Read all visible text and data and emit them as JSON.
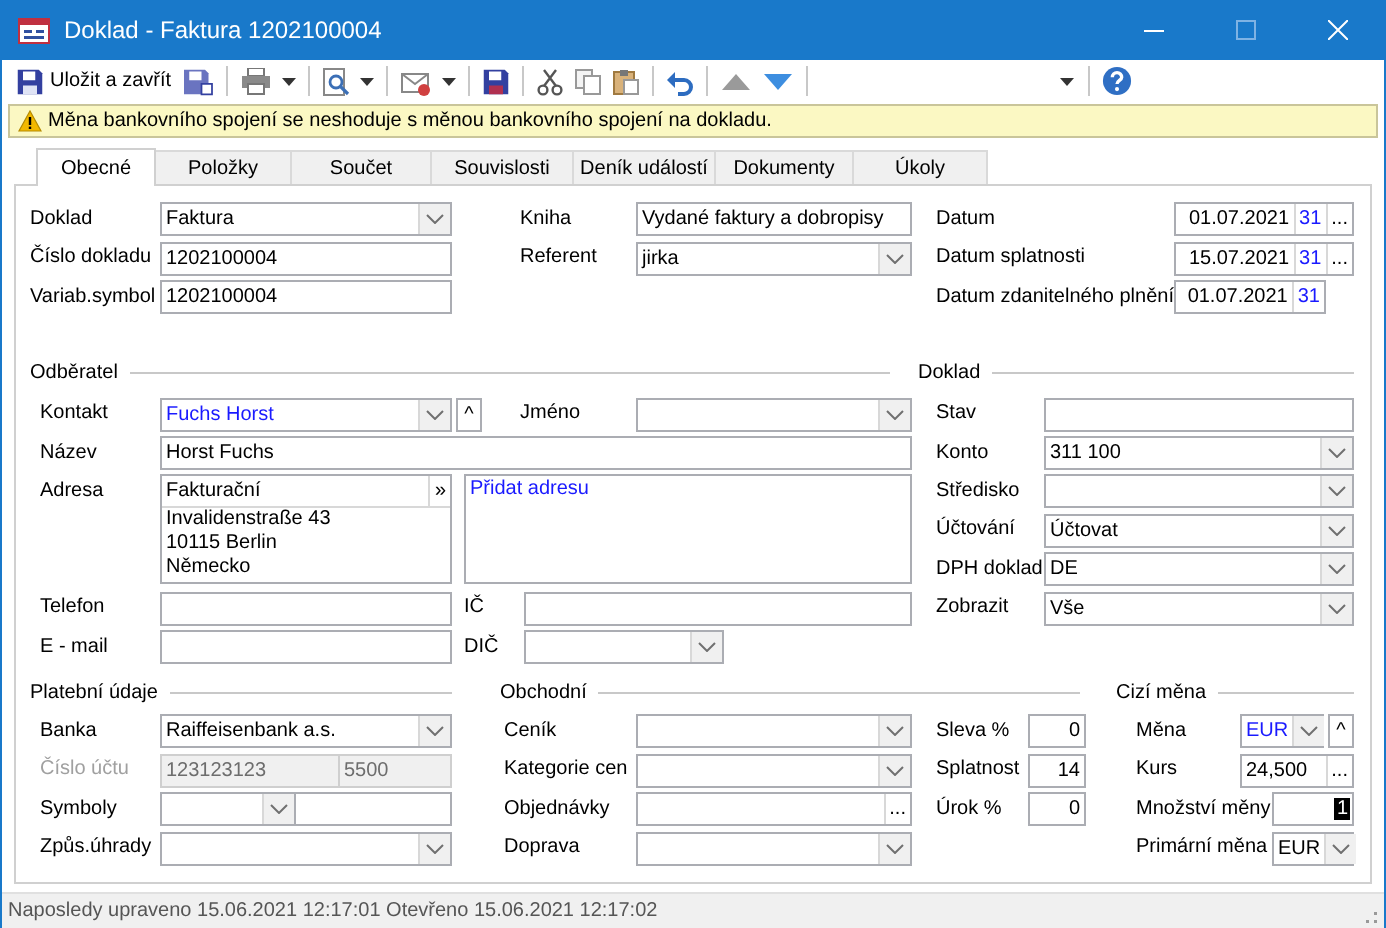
{
  "window": {
    "title": "Doklad - Faktura 1202100004"
  },
  "toolbar": {
    "save_label": "Uložit a zavřít"
  },
  "warning": {
    "text": "Měna bankovního spojení se neshoduje s měnou bankovního spojení na dokladu."
  },
  "tabs": [
    {
      "label": "Obecné",
      "selected": true
    },
    {
      "label": "Položky",
      "selected": false
    },
    {
      "label": "Součet",
      "selected": false
    },
    {
      "label": "Souvislosti",
      "selected": false
    },
    {
      "label": "Deník událostí",
      "selected": false
    },
    {
      "label": "Dokumenty",
      "selected": false
    },
    {
      "label": "Úkoly",
      "selected": false
    }
  ],
  "form": {
    "top": {
      "fields": [
        {
          "label": "Doklad",
          "kind": "combo",
          "value": "Faktura"
        },
        {
          "label": "Číslo dokladu",
          "kind": "text",
          "value": "1202100004"
        },
        {
          "label": "Variab.symbol",
          "kind": "text",
          "value": "1202100004"
        },
        {
          "label": "Kniha",
          "kind": "text",
          "value": "Vydané faktury a dobropisy"
        },
        {
          "label": "Referent",
          "kind": "combo",
          "value": "jirka"
        },
        {
          "label": "Datum",
          "kind": "date",
          "value": "01.07.2021",
          "buttons": [
            "31",
            "..."
          ]
        },
        {
          "label": "Datum splatnosti",
          "kind": "date",
          "value": "15.07.2021",
          "buttons": [
            "31",
            "..."
          ]
        },
        {
          "label": "Datum zdanitelného plnění",
          "kind": "date",
          "value": "01.07.2021",
          "buttons": [
            "31"
          ]
        }
      ]
    },
    "customer": {
      "title": "Odběratel",
      "fields": [
        {
          "label": "Kontakt",
          "kind": "combo_up",
          "value": "Fuchs Horst",
          "linked": true,
          "buttons": [
            "^"
          ]
        },
        {
          "label": "Jméno",
          "kind": "combo"
        },
        {
          "label": "Název",
          "kind": "text",
          "value": "Horst Fuchs"
        },
        {
          "label": "Adresa",
          "kind": "address",
          "type": "Fakturační",
          "lines": [
            "Invalidenstraße 43",
            "10115 Berlin",
            "Německo"
          ],
          "buttons": [
            "»"
          ]
        },
        {
          "kind": "link_box",
          "link": "Přidat adresu"
        },
        {
          "label": "Telefon",
          "kind": "text"
        },
        {
          "label": "IČ",
          "kind": "text"
        },
        {
          "label": "E - mail",
          "kind": "text"
        },
        {
          "label": "DIČ",
          "kind": "combo"
        }
      ]
    },
    "document": {
      "title": "Doklad",
      "fields": [
        {
          "label": "Stav",
          "kind": "text"
        },
        {
          "label": "Konto",
          "kind": "combo",
          "value": "311 100"
        },
        {
          "label": "Středisko",
          "kind": "combo"
        },
        {
          "label": "Účtování",
          "kind": "combo",
          "value": "Účtovat"
        },
        {
          "label": "DPH doklad",
          "kind": "combo",
          "value": "DE"
        },
        {
          "label": "Zobrazit",
          "kind": "combo",
          "value": "Vše"
        }
      ]
    },
    "payment": {
      "title": "Platební údaje",
      "fields": [
        {
          "label": "Banka",
          "kind": "combo",
          "value": "Raiffeisenbank a.s."
        },
        {
          "label": "Číslo účtu",
          "kind": "account",
          "values": [
            "123123123",
            "5500"
          ],
          "disabled": true
        },
        {
          "label": "Symboly",
          "kind": "split_combo"
        },
        {
          "label": "Způs.úhrady",
          "kind": "combo"
        }
      ]
    },
    "commercial": {
      "title": "Obchodní",
      "fields": [
        {
          "label": "Ceník",
          "kind": "combo"
        },
        {
          "label": "Kategorie cen",
          "kind": "combo"
        },
        {
          "label": "Objednávky",
          "kind": "lookup",
          "buttons": [
            "..."
          ]
        },
        {
          "label": "Doprava",
          "kind": "combo"
        },
        {
          "label": "Sleva %",
          "kind": "number",
          "value": "0"
        },
        {
          "label": "Splatnost",
          "kind": "number",
          "value": "14"
        },
        {
          "label": "Úrok %",
          "kind": "number",
          "value": "0"
        }
      ]
    },
    "currency": {
      "title": "Cizí měna",
      "fields": [
        {
          "label": "Měna",
          "kind": "combo_up",
          "value": "EUR",
          "linked": true,
          "buttons": [
            "^"
          ]
        },
        {
          "label": "Kurs",
          "kind": "lookup",
          "value": "24,500",
          "buttons": [
            "..."
          ]
        },
        {
          "label": "Množství měny",
          "kind": "number",
          "value": "1",
          "highlighted": true
        },
        {
          "label": "Primární měna",
          "kind": "combo",
          "value": "EUR"
        }
      ]
    }
  },
  "status_bar": {
    "text": "Naposledy upraveno 15.06.2021 12:17:01 Otevřeno 15.06.2021 12:17:02"
  }
}
